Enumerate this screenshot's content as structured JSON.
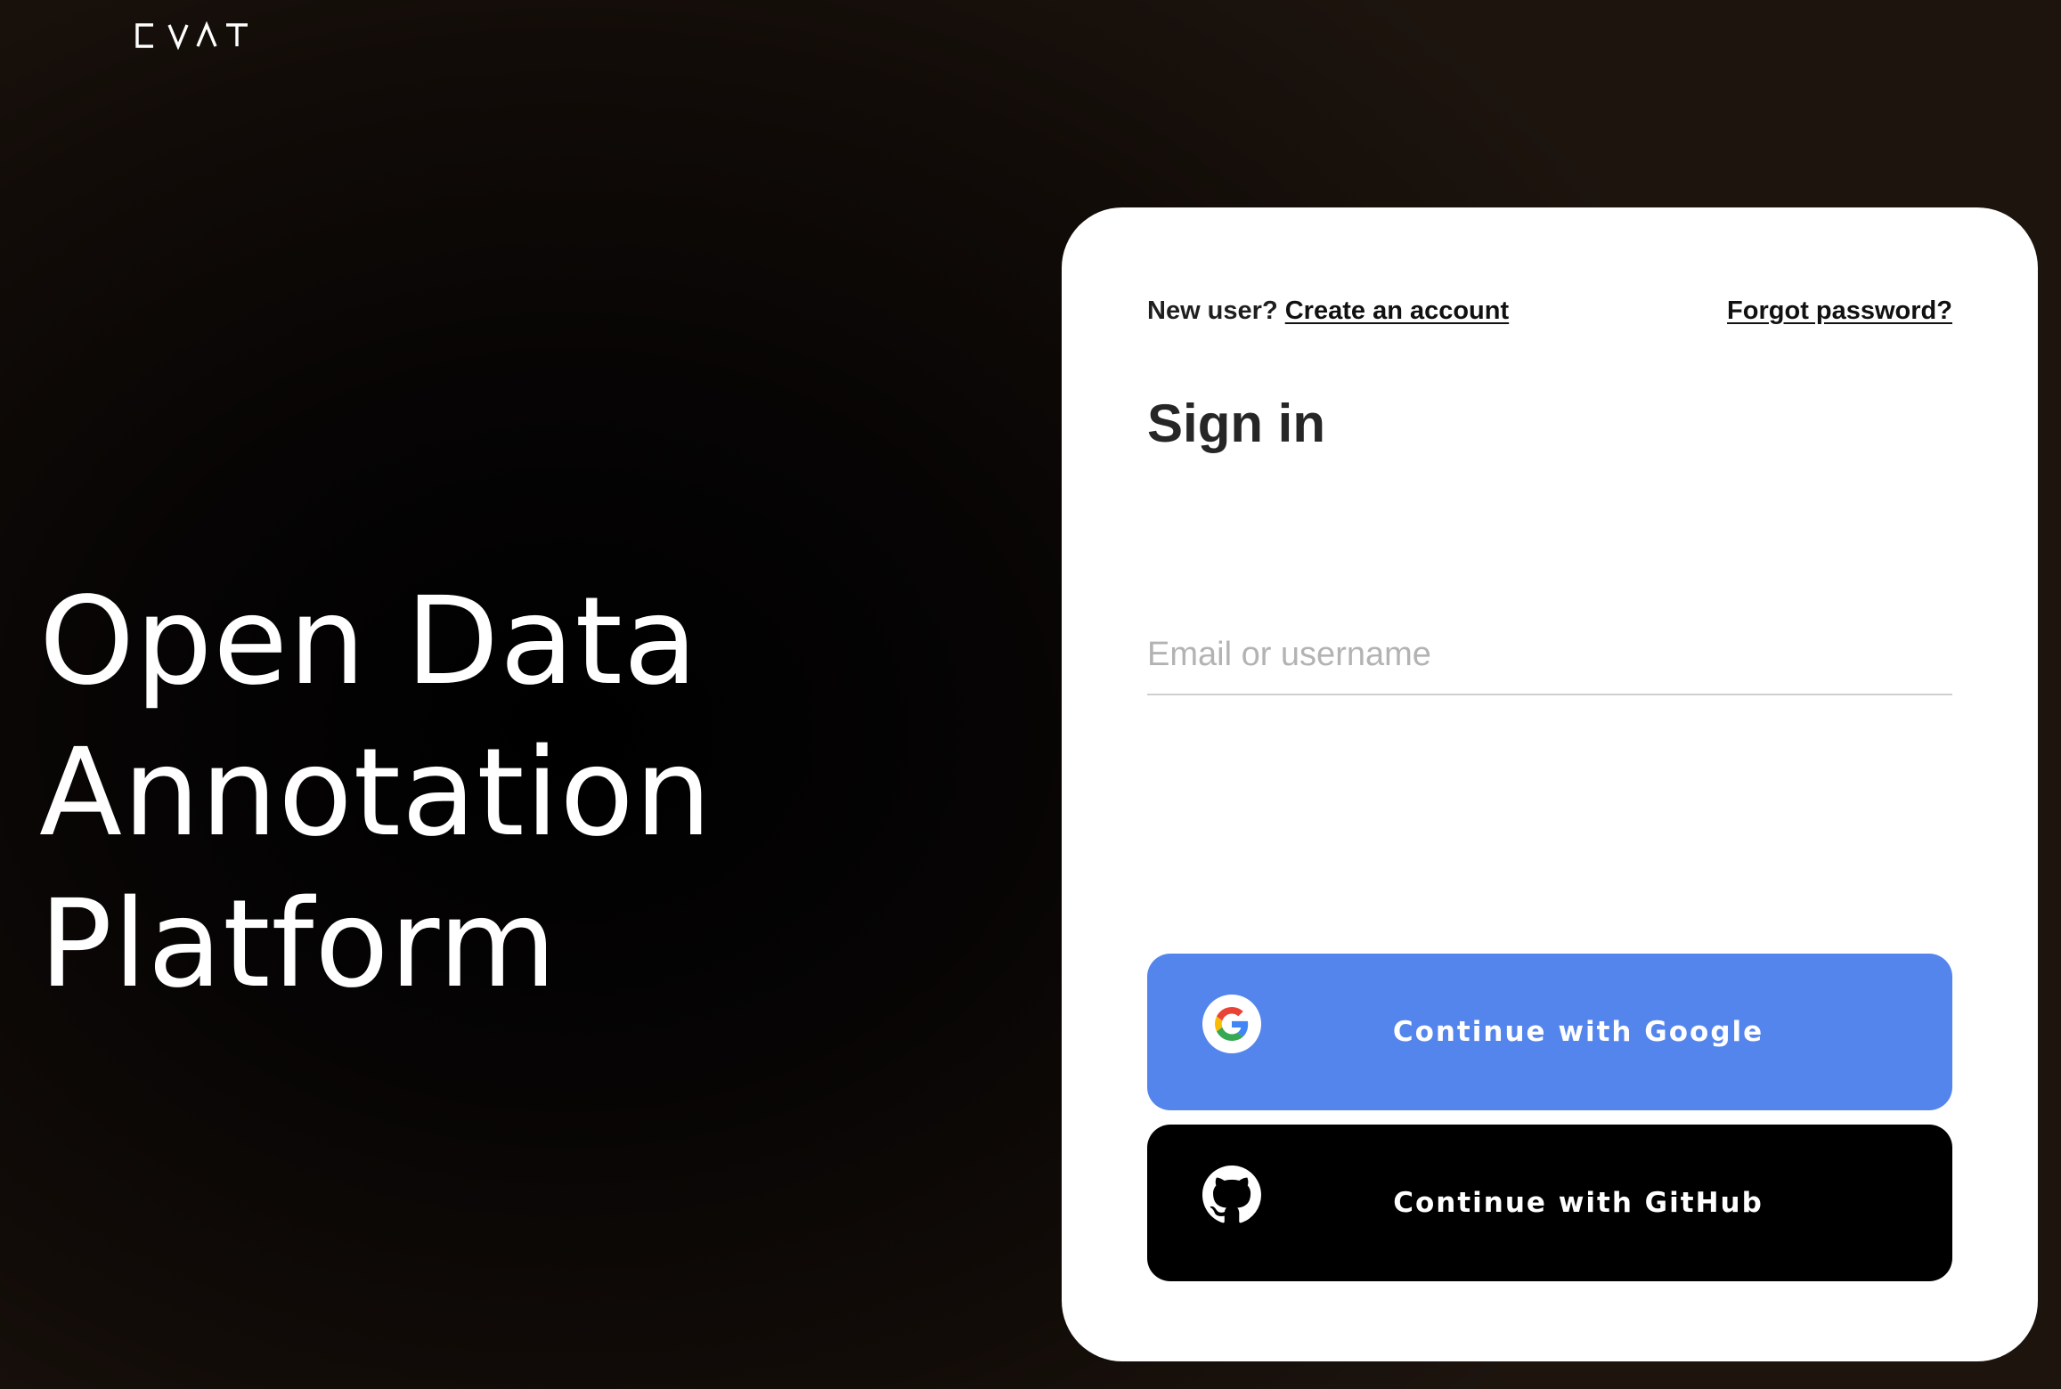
{
  "brand": {
    "logo_text": "CVAT"
  },
  "hero": {
    "lines": [
      "Open Data",
      "Annotation",
      "Platform"
    ]
  },
  "signin": {
    "new_user_text": "New user?",
    "create_account_link": "Create an account",
    "forgot_password_link": "Forgot password?",
    "title": "Sign in",
    "email_field": {
      "placeholder": "Email or username",
      "value": ""
    },
    "google_button": {
      "label": "Continue with Google",
      "icon": "google-icon",
      "color": "#5485ec"
    },
    "github_button": {
      "label": "Continue with GitHub",
      "icon": "github-icon",
      "color": "#000000"
    }
  },
  "colors": {
    "page_background": "#150f0b",
    "card_background": "#ffffff",
    "hero_text": "#ffffff"
  }
}
